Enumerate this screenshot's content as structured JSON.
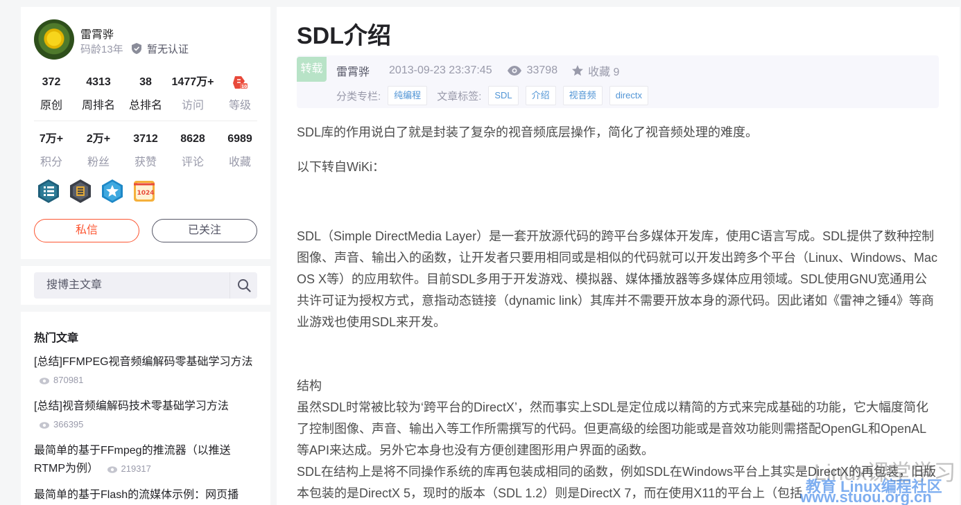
{
  "author": {
    "name": "雷霄骅",
    "years": "码龄13年",
    "cert": "暂无认证"
  },
  "stats_row1": [
    {
      "value": "372",
      "label": "原创"
    },
    {
      "value": "4313",
      "label": "周排名"
    },
    {
      "value": "38",
      "label": "总排名"
    },
    {
      "value": "1477万+",
      "label": "访问"
    },
    {
      "value": "",
      "label": "等级"
    }
  ],
  "stats_row2": [
    {
      "value": "7万+",
      "label": "积分"
    },
    {
      "value": "2万+",
      "label": "粉丝"
    },
    {
      "value": "3712",
      "label": "获赞"
    },
    {
      "value": "8628",
      "label": "评论"
    },
    {
      "value": "6989",
      "label": "收藏"
    }
  ],
  "badges": [
    "list-badge-icon",
    "hexagon-badge-icon",
    "star-badge-icon",
    "badge-1024-icon"
  ],
  "buttons": {
    "message": "私信",
    "follow": "已关注"
  },
  "search": {
    "placeholder": "搜博主文章"
  },
  "hot": {
    "title": "热门文章",
    "items": [
      {
        "title": "[总结]FFMPEG视音频编解码零基础学习方法",
        "views": "870981"
      },
      {
        "title": "[总结]视音频编解码技术零基础学习方法",
        "views": "366395"
      },
      {
        "title": "最简单的基于FFmpeg的推流器（以推送RTMP为例）",
        "views": "219317"
      },
      {
        "title": "最简单的基于Flash的流媒体示例：网页播",
        "views": ""
      }
    ]
  },
  "article": {
    "title": "SDL介绍",
    "repost": "转载",
    "author": "雷霄骅",
    "date": "2013-09-23 23:37:45",
    "views": "33798",
    "fav": "收藏 9",
    "category_label": "分类专栏:",
    "categories": [
      "纯编程"
    ],
    "tags_label": "文章标签:",
    "tags": [
      "SDL",
      "介绍",
      "视音频",
      "directx"
    ],
    "p1": "SDL库的作用说白了就是封装了复杂的视音频底层操作，简化了视音频处理的难度。",
    "p2": "以下转自WiKi：",
    "p3": "SDL（Simple DirectMedia Layer）是一套开放源代码的跨平台多媒体开发库，使用C语言写成。SDL提供了数种控制图像、声音、输出入的函数，让开发者只要用相同或是相似的代码就可以开发出跨多个平台（Linux、Windows、Mac OS X等）的应用软件。目前SDL多用于开发游戏、模拟器、媒体播放器等多媒体应用领域。SDL使用GNU宽通用公共许可证为授权方式，意指动态链接（dynamic link）其库并不需要开放本身的源代码。因此诸如《雷神之锤4》等商业游戏也使用SDL来开发。",
    "h_struct": "结构",
    "p4": "虽然SDL时常被比较为‘跨平台的DirectX’，然而事实上SDL是定位成以精简的方式来完成基础的功能，它大幅度简化了控制图像、声音、输出入等工作所需撰写的代码。但更高级的绘图功能或是音效功能则需搭配OpenGL和OpenAL等API来达成。另外它本身也没有方便创建图形用户界面的函数。",
    "p5": "SDL在结构上是将不同操作系统的库再包装成相同的函数，例如SDL在Windows平台上其实是DirectX的再包装，旧版本包装的是DirectX 5，现时的版本（SDL 1.2）则是DirectX 7，而在使用X11的平台上（包括"
  },
  "watermark": {
    "line1": "Linux课堂学习",
    "line2": "教育 Linux编程社区",
    "line3": "www.stuou.org.cn"
  }
}
